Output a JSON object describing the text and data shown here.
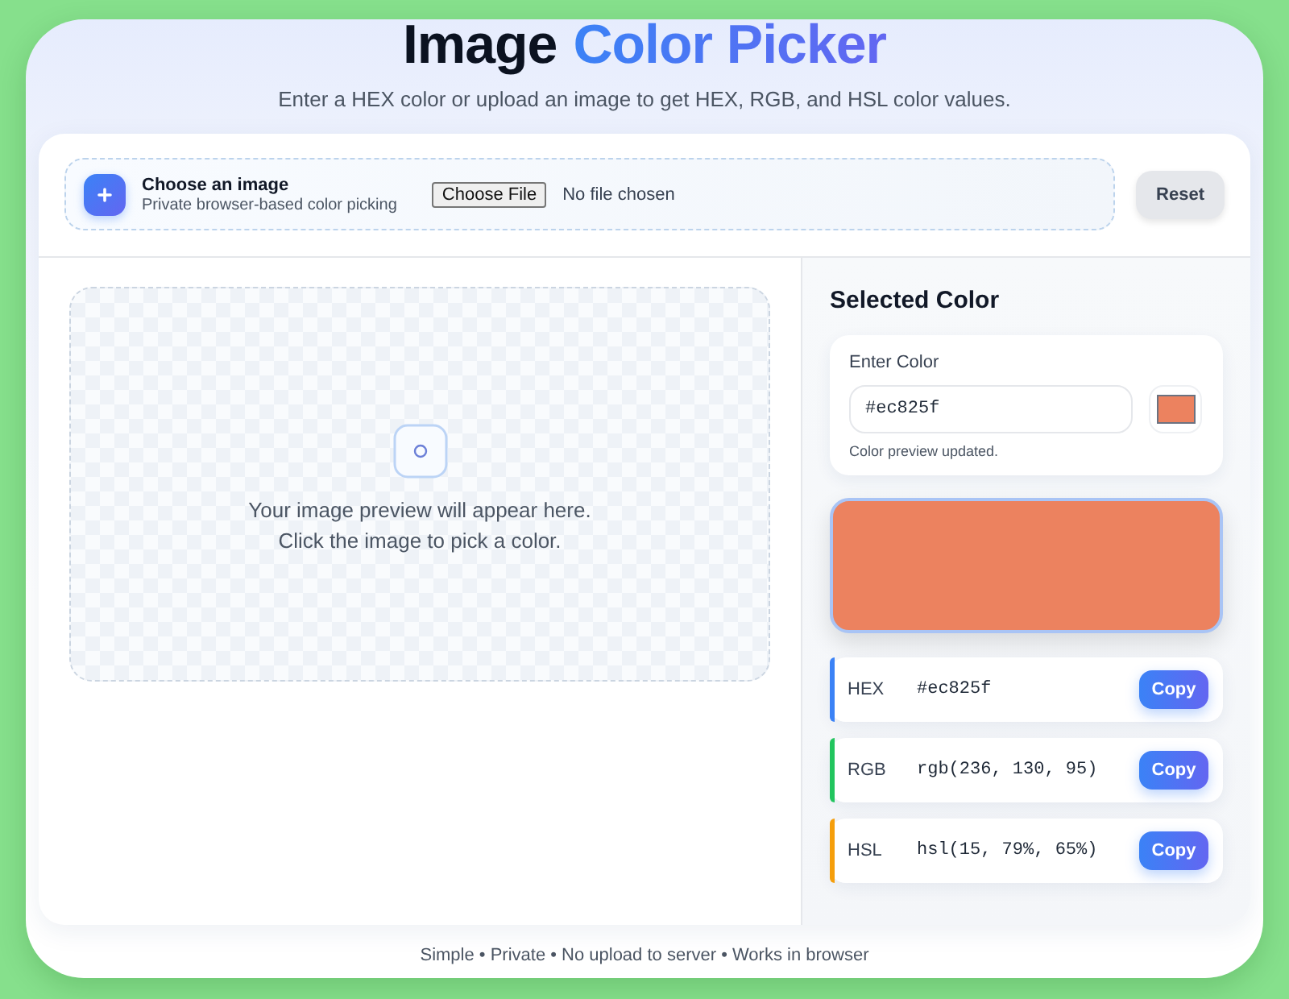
{
  "header": {
    "title": {
      "plain": "Image",
      "accent": "Color Picker"
    },
    "subtitle": "Enter a HEX color or upload an image to get HEX, RGB, and HSL color values."
  },
  "upload": {
    "heading": "Choose an image",
    "description": "Private browser-based color picking",
    "file_button": "Choose File",
    "file_status": "No file chosen",
    "reset_button": "Reset"
  },
  "preview_area": {
    "lines": [
      "Your image preview will appear here.",
      "Click the image to pick a color."
    ]
  },
  "selected_color": {
    "heading": "Selected Color",
    "input_label": "Enter Color",
    "input_value": "#ec825f",
    "hint": "Color preview updated.",
    "color": "#ec825f"
  },
  "formats": [
    {
      "label": "HEX",
      "value": "#ec825f",
      "color": "#3b82f6",
      "button": "Copy"
    },
    {
      "label": "RGB",
      "value": "rgb(236, 130, 95)",
      "color": "#22c55e",
      "button": "Copy"
    },
    {
      "label": "HSL",
      "value": "hsl(15, 79%, 65%)",
      "color": "#f59e0b",
      "button": "Copy"
    }
  ],
  "footer": "Simple • Private • No upload to server • Works in browser"
}
